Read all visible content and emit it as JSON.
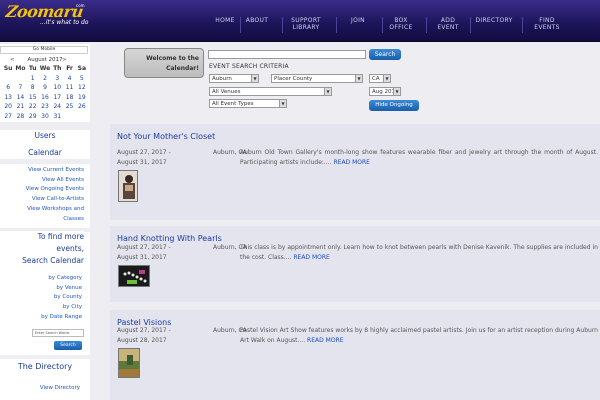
{
  "header": {
    "logo_text": "Zoomaru",
    "logo_tm": "com",
    "tagline": "...it's what to do",
    "nav": [
      {
        "line1": "HOME",
        "line2": ""
      },
      {
        "line1": "ABOUT",
        "line2": ""
      },
      {
        "line1": "SUPPORT",
        "line2": "LIBRARY"
      },
      {
        "line1": "JOIN",
        "line2": ""
      },
      {
        "line1": "BOX",
        "line2": "OFFICE"
      },
      {
        "line1": "ADD",
        "line2": "EVENT"
      },
      {
        "line1": "DIRECTORY",
        "line2": ""
      },
      {
        "line1": "FIND",
        "line2": "EVENTS"
      }
    ],
    "colors": {
      "bar": "#1c1458",
      "logo": "#f4c20c"
    }
  },
  "sidebar": {
    "badge": "Go Mobile",
    "calendar": {
      "prev": "<",
      "month": "August 2017",
      "next": ">",
      "dow": [
        "Su",
        "Mo",
        "Tu",
        "We",
        "Th",
        "Fr",
        "Sa"
      ],
      "weeks": [
        [
          "",
          "",
          "1",
          "2",
          "3",
          "4",
          "5"
        ],
        [
          "6",
          "7",
          "8",
          "9",
          "10",
          "11",
          "12"
        ],
        [
          "13",
          "14",
          "15",
          "16",
          "17",
          "18",
          "19"
        ],
        [
          "20",
          "21",
          "22",
          "23",
          "24",
          "25",
          "26"
        ],
        [
          "27",
          "28",
          "29",
          "30",
          "31",
          "",
          ""
        ]
      ]
    },
    "users_title_1": "Users",
    "users_title_2": "Calendar",
    "users_links": [
      "View Current Events",
      "View All Events",
      "View Ongoing Events",
      "View Call-to-Artists",
      "View Workshops and",
      "Classes"
    ],
    "find_title_1": "To find more",
    "find_title_2": "events,",
    "find_title_3": "Search Calendar",
    "find_links": [
      "by Category",
      "by Venue",
      "by County",
      "by City",
      "by Date Range"
    ],
    "search_placeholder": "Enter Search Words",
    "search_button": "Search",
    "directory_title": "The Directory",
    "directory_link": "View Directory"
  },
  "search": {
    "welcome_1": "Welcome to the",
    "welcome_2": "Calendar!",
    "input_value": "",
    "button": "Search",
    "criteria_label": "EVENT SEARCH CRITERIA",
    "city": "Auburn",
    "county": "Placer County",
    "state": "CA",
    "venue": "All Venues",
    "month": "Aug 2017",
    "type": "All Event Types",
    "hide_button": "Hide Ongoing"
  },
  "events": [
    {
      "title": "Not Your Mother's Closet",
      "date1": "August 27, 2017 -",
      "date2": "August 31, 2017",
      "location": "Auburn, CA",
      "desc": "Auburn Old Town Gallery's month-long show features wearable fiber and jewelry art through the month of August. Participating artists include:....",
      "more": "READ MORE"
    },
    {
      "title": "Hand Knotting With Pearls",
      "date1": "August 27, 2017 -",
      "date2": "August 31, 2017",
      "location": "Auburn, CA",
      "desc": "This class is by appointment only. Learn how to knot between pearls with Denise Kavenik. The supplies are included in the cost. Class....",
      "more": "READ MORE"
    },
    {
      "title": "Pastel Visions",
      "date1": "August 27, 2017 -",
      "date2": "August 28, 2017",
      "location": "Auburn, CA",
      "desc": "Pastel Vision Art Show features works by 8 highly acclaimed pastel artists. Join us for an artist reception during Auburn Art Walk on August....",
      "more": "READ MORE"
    }
  ]
}
